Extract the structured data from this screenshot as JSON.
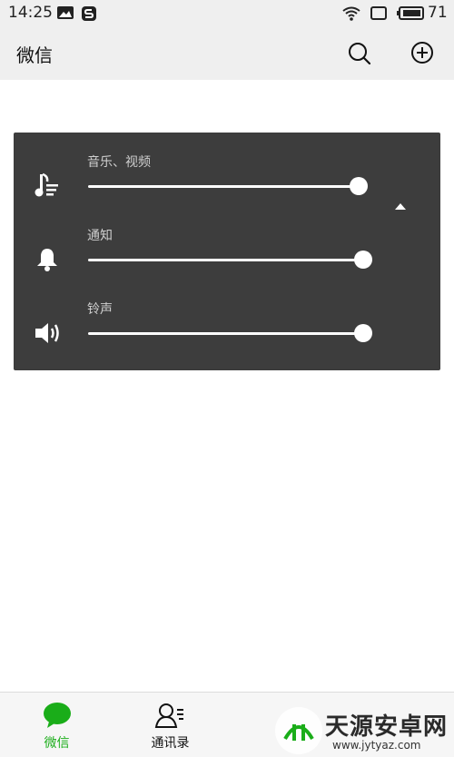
{
  "status_bar": {
    "time": "14:25",
    "battery": "71"
  },
  "header": {
    "title": "微信"
  },
  "volume_panel": {
    "rows": [
      {
        "label": "音乐、视频",
        "level": 0.97
      },
      {
        "label": "通知",
        "level": 1.0
      },
      {
        "label": "铃声",
        "level": 1.0
      }
    ]
  },
  "bottom_nav": {
    "items": [
      {
        "label": "微信"
      },
      {
        "label": "通讯录"
      }
    ]
  },
  "watermark": {
    "text": "天源安卓网",
    "url": "www.jytyaz.com"
  },
  "colors": {
    "accent": "#1aad19",
    "panel": "#3d3d3d",
    "header_bg": "#efefef"
  },
  "icons": [
    "image-icon",
    "s-app-icon",
    "wifi-icon",
    "screen-icon",
    "battery-icon",
    "search-icon",
    "add-icon",
    "music-list-icon",
    "bell-icon",
    "speaker-icon",
    "caret-up-icon",
    "chat-icon",
    "contacts-icon"
  ]
}
